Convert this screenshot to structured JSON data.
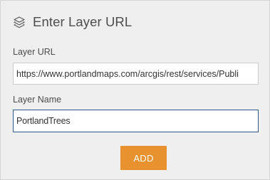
{
  "dialog": {
    "title": "Enter Layer URL",
    "title_icon": "layers-icon"
  },
  "form": {
    "url_label": "Layer URL",
    "url_value": "https://www.portlandmaps.com/arcgis/rest/services/Publi",
    "name_label": "Layer Name",
    "name_value": "PortlandTrees",
    "add_button_label": "ADD"
  },
  "colors": {
    "panel_background": "#efefef",
    "add_button": "#e8922f",
    "focused_input_border": "#2d5b85"
  }
}
